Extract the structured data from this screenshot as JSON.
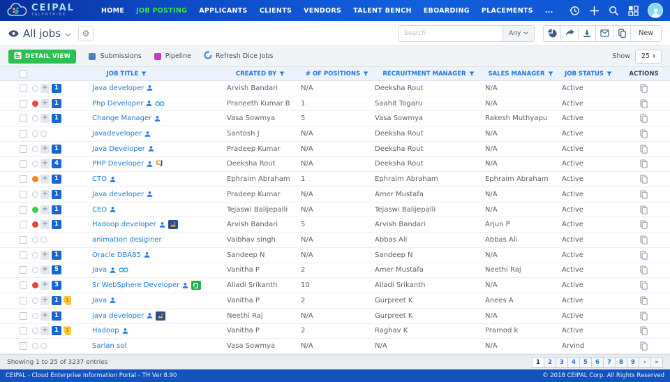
{
  "header": {
    "logo": {
      "title": "CEIPAL",
      "subtitle": "TALENTHIRE"
    },
    "nav": [
      {
        "label": "HOME",
        "active": false
      },
      {
        "label": "JOB POSTING",
        "active": true
      },
      {
        "label": "APPLICANTS",
        "active": false
      },
      {
        "label": "CLIENTS",
        "active": false
      },
      {
        "label": "VENDORS",
        "active": false
      },
      {
        "label": "TALENT BENCH",
        "active": false
      },
      {
        "label": "EBOARDING",
        "active": false
      },
      {
        "label": "PLACEMENTS",
        "active": false
      },
      {
        "label": "...",
        "active": false
      }
    ],
    "icons": [
      "history-icon",
      "plus-icon",
      "search-icon",
      "grid-icon",
      "avatar"
    ]
  },
  "toolbar": {
    "view_title": "All jobs",
    "search_placeholder": "Search",
    "filter_value": "Any",
    "action_icons": [
      "pie-chart",
      "share",
      "download",
      "mail",
      "copy"
    ],
    "new_label": "New"
  },
  "subtoolbar": {
    "detail_view_label": "DETAIL VIEW",
    "legend": [
      {
        "label": "Submissions",
        "color": "#4a7fc1"
      },
      {
        "label": "Pipeline",
        "color": "#c837c8"
      }
    ],
    "refresh_label": "Refresh Dice Jobs",
    "show_label": "Show",
    "page_size": "25"
  },
  "table": {
    "columns": [
      {
        "label": "JOB TITLE",
        "filter": true
      },
      {
        "label": "CREATED BY",
        "filter": true
      },
      {
        "label": "# OF POSITIONS",
        "filter": true
      },
      {
        "label": "RECRUITMENT MANAGER",
        "filter": true
      },
      {
        "label": "SALES MANAGER",
        "filter": true
      },
      {
        "label": "JOB STATUS",
        "filter": true
      },
      {
        "label": "ACTIONS",
        "filter": false
      }
    ],
    "rows": [
      {
        "title": "Java developer",
        "title_icons": [
          "user"
        ],
        "circles": [
          "gray"
        ],
        "plus": true,
        "count": "1",
        "tag": null,
        "created_by": "Arvish Bandari",
        "positions": "N/A",
        "recruitment_manager": "Deeksha Rout",
        "sales_manager": "N/A",
        "status": "Active"
      },
      {
        "title": "Php Developer",
        "title_icons": [
          "user",
          "dice"
        ],
        "circles": [
          "red"
        ],
        "plus": true,
        "count": "1",
        "tag": null,
        "created_by": "Praneeth Kumar B",
        "positions": "1",
        "recruitment_manager": "Saahit Togaru",
        "sales_manager": "N/A",
        "status": "Active"
      },
      {
        "title": "Change Manager",
        "title_icons": [
          "user"
        ],
        "circles": [
          "gray"
        ],
        "plus": true,
        "count": "1",
        "tag": null,
        "created_by": "Vasa Sowmya",
        "positions": "5",
        "recruitment_manager": "Vasa Sowmya",
        "sales_manager": "Rakesh Muthyapu",
        "status": "Active"
      },
      {
        "title": "Javadeveloper",
        "title_icons": [
          "user"
        ],
        "circles": [
          "gray",
          "gray"
        ],
        "plus": false,
        "count": null,
        "tag": null,
        "created_by": "Santosh J",
        "positions": "N/A",
        "recruitment_manager": "Deeksha Rout",
        "sales_manager": "N/A",
        "status": "Active"
      },
      {
        "title": "Java Developer",
        "title_icons": [
          "user"
        ],
        "circles": [
          "gray"
        ],
        "plus": true,
        "count": "1",
        "tag": null,
        "created_by": "Pradeep Kumar",
        "positions": "N/A",
        "recruitment_manager": "Deeksha Rout",
        "sales_manager": "N/A",
        "status": "Active"
      },
      {
        "title": "PHP Developer",
        "title_icons": [
          "user",
          "careerjet"
        ],
        "circles": [
          "gray"
        ],
        "plus": true,
        "count": "4",
        "tag": null,
        "created_by": "Deeksha Rout",
        "positions": "N/A",
        "recruitment_manager": "Deeksha Rout",
        "sales_manager": "N/A",
        "status": "Active"
      },
      {
        "title": "CTO",
        "title_icons": [
          "user"
        ],
        "circles": [
          "orange"
        ],
        "plus": true,
        "count": "1",
        "tag": null,
        "created_by": "Ephraim Abraham",
        "positions": "1",
        "recruitment_manager": "Ephraim Abraham",
        "sales_manager": "Ephraim Abraham",
        "status": "Active"
      },
      {
        "title": "Java developer",
        "title_icons": [
          "user"
        ],
        "circles": [
          "gray"
        ],
        "plus": true,
        "count": "1",
        "tag": null,
        "created_by": "Pradeep Kumar",
        "positions": "N/A",
        "recruitment_manager": "Amer Mustafa",
        "sales_manager": "N/A",
        "status": "Active"
      },
      {
        "title": "CEO",
        "title_icons": [
          "user"
        ],
        "circles": [
          "green"
        ],
        "plus": true,
        "count": "1",
        "tag": null,
        "created_by": "Tejaswi Balijepalli",
        "positions": "N/A",
        "recruitment_manager": "Tejaswi Balijepalli",
        "sales_manager": "N/A",
        "status": "Active"
      },
      {
        "title": "Hadoop developer",
        "title_icons": [
          "user",
          "monster"
        ],
        "circles": [
          "red"
        ],
        "plus": true,
        "count": "1",
        "tag": null,
        "created_by": "Arvish Bandari",
        "positions": "5",
        "recruitment_manager": "Arvish Bandari",
        "sales_manager": "Arjun P",
        "status": "Active"
      },
      {
        "title": "animation desiginer",
        "title_icons": [],
        "circles": [
          "gray",
          "gray"
        ],
        "plus": false,
        "count": null,
        "tag": null,
        "created_by": "Vaibhav singh",
        "positions": "N/A",
        "recruitment_manager": "Abbas Ali",
        "sales_manager": "Abbas Ali",
        "status": "Active"
      },
      {
        "title": "Oracle DBA85",
        "title_icons": [
          "user"
        ],
        "circles": [
          "gray"
        ],
        "plus": true,
        "count": "1",
        "tag": null,
        "created_by": "Sandeep N",
        "positions": "N/A",
        "recruitment_manager": "Sandeep N",
        "sales_manager": "N/A",
        "status": "Active"
      },
      {
        "title": "Java",
        "title_icons": [
          "user",
          "dice"
        ],
        "circles": [
          "gray"
        ],
        "plus": true,
        "count": "5",
        "tag": null,
        "created_by": "Vanitha P",
        "positions": "2",
        "recruitment_manager": "Amer Mustafa",
        "sales_manager": "Neethi Raj",
        "status": "Active"
      },
      {
        "title": "Sr WebSphere Developer",
        "title_icons": [
          "user",
          "glassdoor"
        ],
        "circles": [
          "red"
        ],
        "plus": true,
        "count": "3",
        "tag": null,
        "created_by": "Alladi Srikanth",
        "positions": "10",
        "recruitment_manager": "Alladi Srikanth",
        "sales_manager": "N/A",
        "status": "Active"
      },
      {
        "title": "Java",
        "title_icons": [
          "user"
        ],
        "circles": [
          "gray"
        ],
        "plus": true,
        "count": "1",
        "tag": "1",
        "created_by": "Vanitha P",
        "positions": "2",
        "recruitment_manager": "Gurpreet K",
        "sales_manager": "Anees A",
        "status": "Active"
      },
      {
        "title": "java developer",
        "title_icons": [
          "user",
          "monster"
        ],
        "circles": [
          "gray"
        ],
        "plus": true,
        "count": "1",
        "tag": null,
        "created_by": "Neethi Raj",
        "positions": "N/A",
        "recruitment_manager": "Gurpreet K",
        "sales_manager": "N/A",
        "status": "Active"
      },
      {
        "title": "Hadoop",
        "title_icons": [
          "user"
        ],
        "circles": [
          "gray"
        ],
        "plus": true,
        "count": "1",
        "tag": "1",
        "created_by": "Vanitha P",
        "positions": "2",
        "recruitment_manager": "Raghav K",
        "sales_manager": "Pramod k",
        "status": "Active"
      },
      {
        "title": "Sarlan sol",
        "title_icons": [],
        "circles": [
          "gray",
          "gray"
        ],
        "plus": false,
        "count": null,
        "tag": null,
        "created_by": "Vasa Sowmya",
        "positions": "N/A",
        "recruitment_manager": "N/A",
        "sales_manager": "N/A",
        "status": "Arvind"
      }
    ]
  },
  "footer": {
    "showing": "Showing 1 to 25 of 3237 entries",
    "pages": [
      "1",
      "2",
      "3",
      "4",
      "5",
      "6",
      "7",
      "8",
      "9",
      "›",
      "»"
    ],
    "active_page": "1"
  },
  "statusbar": {
    "left": "CEIPAL - Cloud Enterprise Information Portal - TH Ver 8.90",
    "right": "© 2018 CEIPAL Corp. All Rights Reserved"
  },
  "colors": {
    "header_blue": "#1160dd",
    "active_nav_green": "#3fe53f",
    "link_blue": "#2478da",
    "detail_view_green": "#2fbe52",
    "badge_blue": "#1766d1",
    "submissions_blue": "#4a7fc1",
    "pipeline_magenta": "#c837c8",
    "status_red": "#e8453c",
    "status_orange": "#f58220",
    "status_green": "#2dd54a",
    "tag_yellow": "#f7c83d",
    "statusbar_blue": "#1452bd"
  }
}
